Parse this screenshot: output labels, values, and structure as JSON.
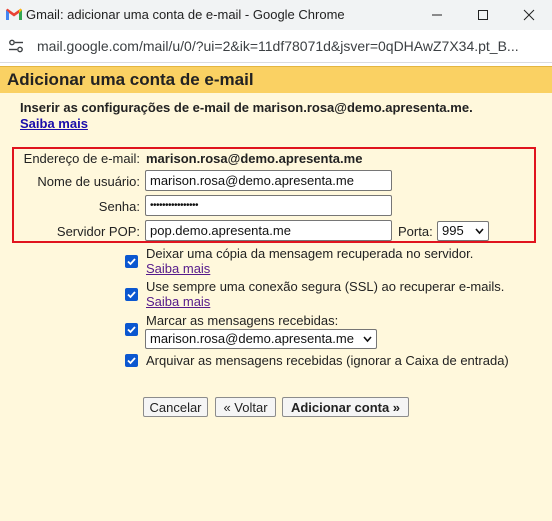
{
  "window": {
    "title": "Gmail: adicionar uma conta de e-mail - Google Chrome",
    "url": "mail.google.com/mail/u/0/?ui=2&ik=11df78071d&jsver=0qDHAwZ7X34.pt_B..."
  },
  "dialog": {
    "title": "Adicionar uma conta de e-mail",
    "instructions": "Inserir as configurações de e-mail de marison.rosa@demo.apresenta.me.",
    "learn_more": "Saiba mais"
  },
  "form": {
    "email_label": "Endereço de e-mail:",
    "email_value": "marison.rosa@demo.apresenta.me",
    "username_label": "Nome de usuário:",
    "username_value": "marison.rosa@demo.apresenta.me",
    "password_label": "Senha:",
    "password_value": "••••••••••••••••",
    "pop_label": "Servidor POP:",
    "pop_value": "pop.demo.apresenta.me",
    "port_label": "Porta:",
    "port_value": "995"
  },
  "options": [
    {
      "label": "Deixar uma cópia da mensagem recuperada no servidor.",
      "checked": true,
      "link": "Saiba mais"
    },
    {
      "label": "Use sempre uma conexão segura (SSL) ao recuperar e-mails.",
      "checked": true,
      "link": "Saiba mais"
    },
    {
      "label": "Marcar as mensagens recebidas:",
      "checked": true,
      "select": "marison.rosa@demo.apresenta.me"
    },
    {
      "label": "Arquivar as mensagens recebidas (ignorar a Caixa de entrada)",
      "checked": true
    }
  ],
  "buttons": {
    "cancel": "Cancelar",
    "back": "« Voltar",
    "add": "Adicionar conta »"
  },
  "colors": {
    "header": "#fad163",
    "body": "#fff8dc",
    "highlight_border": "#e0141e",
    "checkbox": "#0b57d0"
  }
}
